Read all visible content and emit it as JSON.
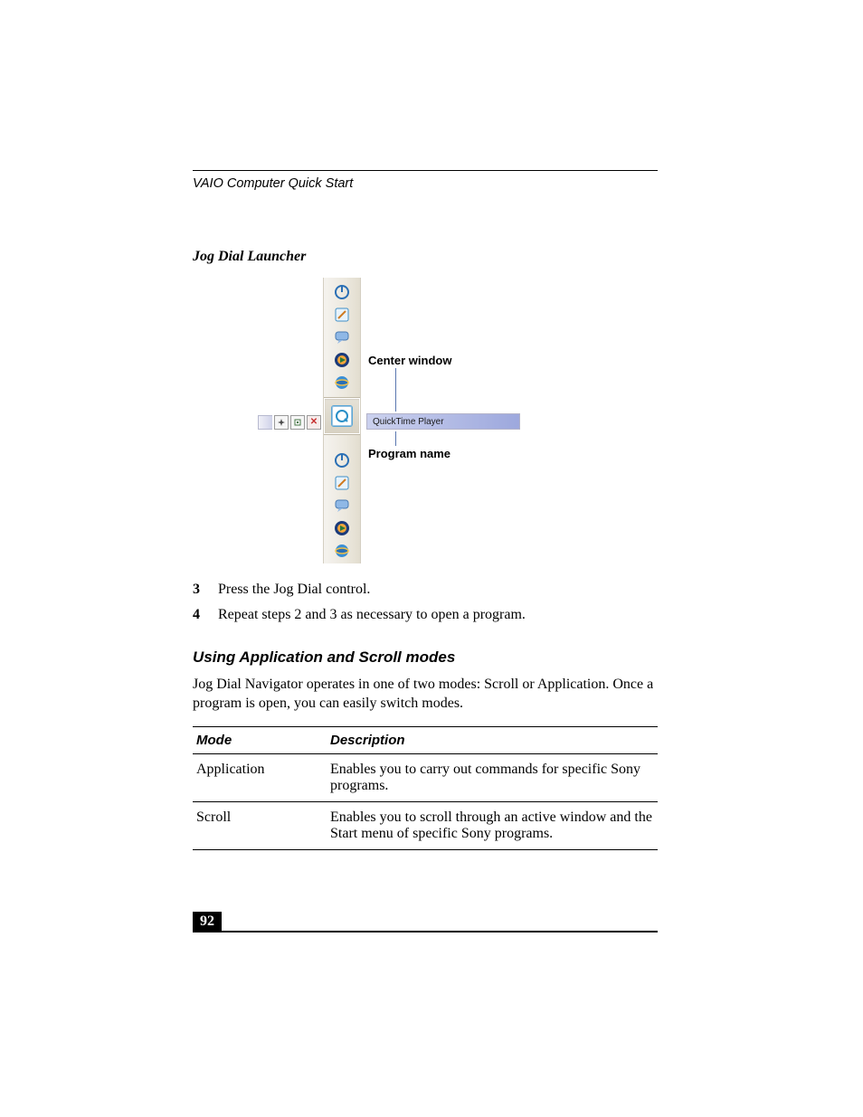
{
  "header": {
    "running_head": "VAIO Computer Quick Start"
  },
  "figure": {
    "caption": "Jog Dial Launcher",
    "tooltip": "QuickTime Player",
    "callouts": {
      "center": "Center window",
      "program": "Program name"
    },
    "dock_icons_top": [
      "power-icon",
      "note-icon",
      "chat-icon",
      "media-icon",
      "ie-icon"
    ],
    "dock_icons_bottom": [
      "power-icon",
      "note-icon",
      "chat-icon",
      "media-icon",
      "ie-icon"
    ]
  },
  "steps": [
    {
      "num": "3",
      "text": "Press the Jog Dial control."
    },
    {
      "num": "4",
      "text": "Repeat steps 2 and 3 as necessary to open a program."
    }
  ],
  "section": {
    "heading": "Using Application and Scroll modes",
    "body": "Jog Dial Navigator operates in one of two modes: Scroll or Application. Once a program is open, you can easily switch modes."
  },
  "table": {
    "headers": {
      "mode": "Mode",
      "desc": "Description"
    },
    "rows": [
      {
        "mode": "Application",
        "desc": "Enables you to carry out commands for specific Sony programs."
      },
      {
        "mode": "Scroll",
        "desc": "Enables you to scroll through an active window and the Start menu of specific Sony programs."
      }
    ]
  },
  "footer": {
    "page_number": "92"
  }
}
